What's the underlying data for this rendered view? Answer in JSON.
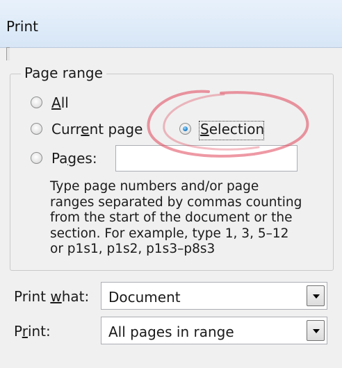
{
  "window": {
    "title": "Print"
  },
  "page_range": {
    "legend": "Page range",
    "options": [
      {
        "id": "all",
        "accel": "A",
        "rest": "ll",
        "checked": false
      },
      {
        "id": "current",
        "pre": "Curr",
        "accel": "e",
        "rest": "nt page",
        "checked": false
      },
      {
        "id": "selection",
        "accel": "S",
        "rest": "election",
        "checked": true
      },
      {
        "id": "pages",
        "pre": "Pa",
        "accel": "g",
        "rest": "es:",
        "checked": false
      }
    ],
    "pages_value": "",
    "help_lines": [
      "Type page numbers and/or page",
      "ranges separated by commas counting",
      "from the start of the document or the",
      "section. For example, type 1, 3, 5–12",
      "or p1s1, p1s2, p1s3–p8s3"
    ]
  },
  "print_what": {
    "pre": "Print ",
    "accel": "w",
    "rest": "hat:",
    "value": "Document"
  },
  "print": {
    "pre": "P",
    "accel": "r",
    "rest": "int:",
    "value": "All pages in range"
  },
  "colors": {
    "annotation": "#e0455a",
    "radio_selected": "#2d8ad0"
  },
  "icons": [
    "radio-icon",
    "dropdown-arrow-icon"
  ]
}
